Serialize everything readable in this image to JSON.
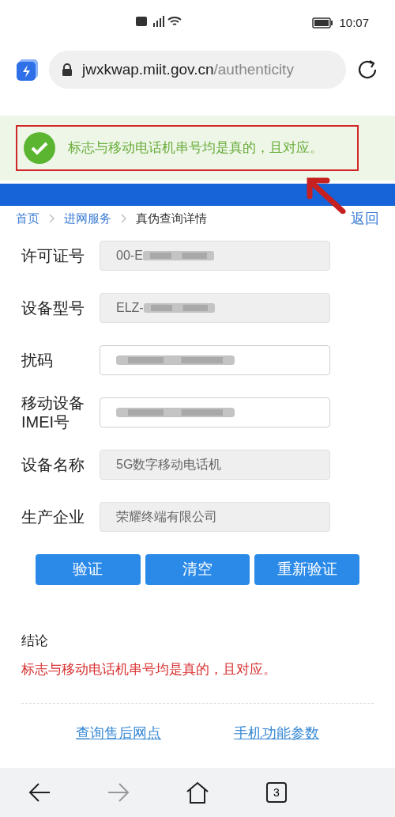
{
  "status_bar": {
    "time": "10:07"
  },
  "browser": {
    "url_host": "jwxkwap.miit.gov.cn",
    "url_path": "/authenticity"
  },
  "toast": {
    "message": "标志与移动电话机串号均是真的，且对应。"
  },
  "breadcrumb": {
    "items": [
      "首页",
      "进网服务",
      "真伪查询详情"
    ],
    "back": "返回"
  },
  "form": {
    "fields": [
      {
        "label": "许可证号",
        "value": "00-E",
        "blurred": true,
        "disabled": true
      },
      {
        "label": "设备型号",
        "value": "ELZ-",
        "blurred": true,
        "disabled": true
      },
      {
        "label": "扰码",
        "blurred": true,
        "disabled": false
      },
      {
        "label": "移动设备IMEI号",
        "blurred": true,
        "disabled": false
      },
      {
        "label": "设备名称",
        "value": "5G数字移动电话机",
        "blurred": false,
        "disabled": true
      },
      {
        "label": "生产企业",
        "value": "荣耀终端有限公司",
        "blurred": false,
        "disabled": true
      }
    ],
    "buttons": [
      "验证",
      "清空",
      "重新验证"
    ]
  },
  "conclusion": {
    "title": "结论",
    "text": "标志与移动电话机串号均是真的，且对应。"
  },
  "links": [
    "查询售后网点",
    "手机功能参数"
  ],
  "bottom_nav": {
    "tab_count": "3",
    "forward_disabled": true
  }
}
